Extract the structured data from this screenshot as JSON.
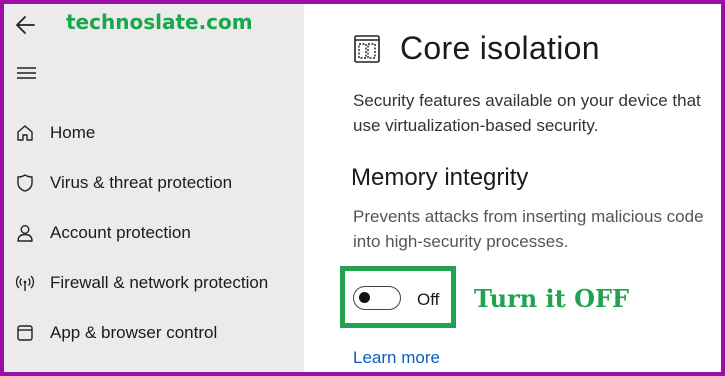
{
  "watermark": "technoslate.com",
  "sidebar": {
    "items": [
      {
        "label": "Home",
        "icon": "home-icon"
      },
      {
        "label": "Virus & threat protection",
        "icon": "shield-icon"
      },
      {
        "label": "Account protection",
        "icon": "person-icon"
      },
      {
        "label": "Firewall & network protection",
        "icon": "antenna-icon"
      },
      {
        "label": "App & browser control",
        "icon": "window-icon"
      }
    ]
  },
  "main": {
    "title": "Core isolation",
    "title_icon": "core-isolation-icon",
    "description": "Security features available on your device that use virtualization-based security.",
    "section": {
      "title": "Memory integrity",
      "description": "Prevents attacks from inserting malicious code into high-security  processes.",
      "toggle_state": "Off",
      "toggle_on": false
    },
    "annotation": "Turn it OFF",
    "learn_more": "Learn more"
  },
  "colors": {
    "border": "#9c0fa6",
    "sidebar_bg": "#ebebeb",
    "highlight": "#21a24f",
    "link": "#0a5fbf"
  }
}
